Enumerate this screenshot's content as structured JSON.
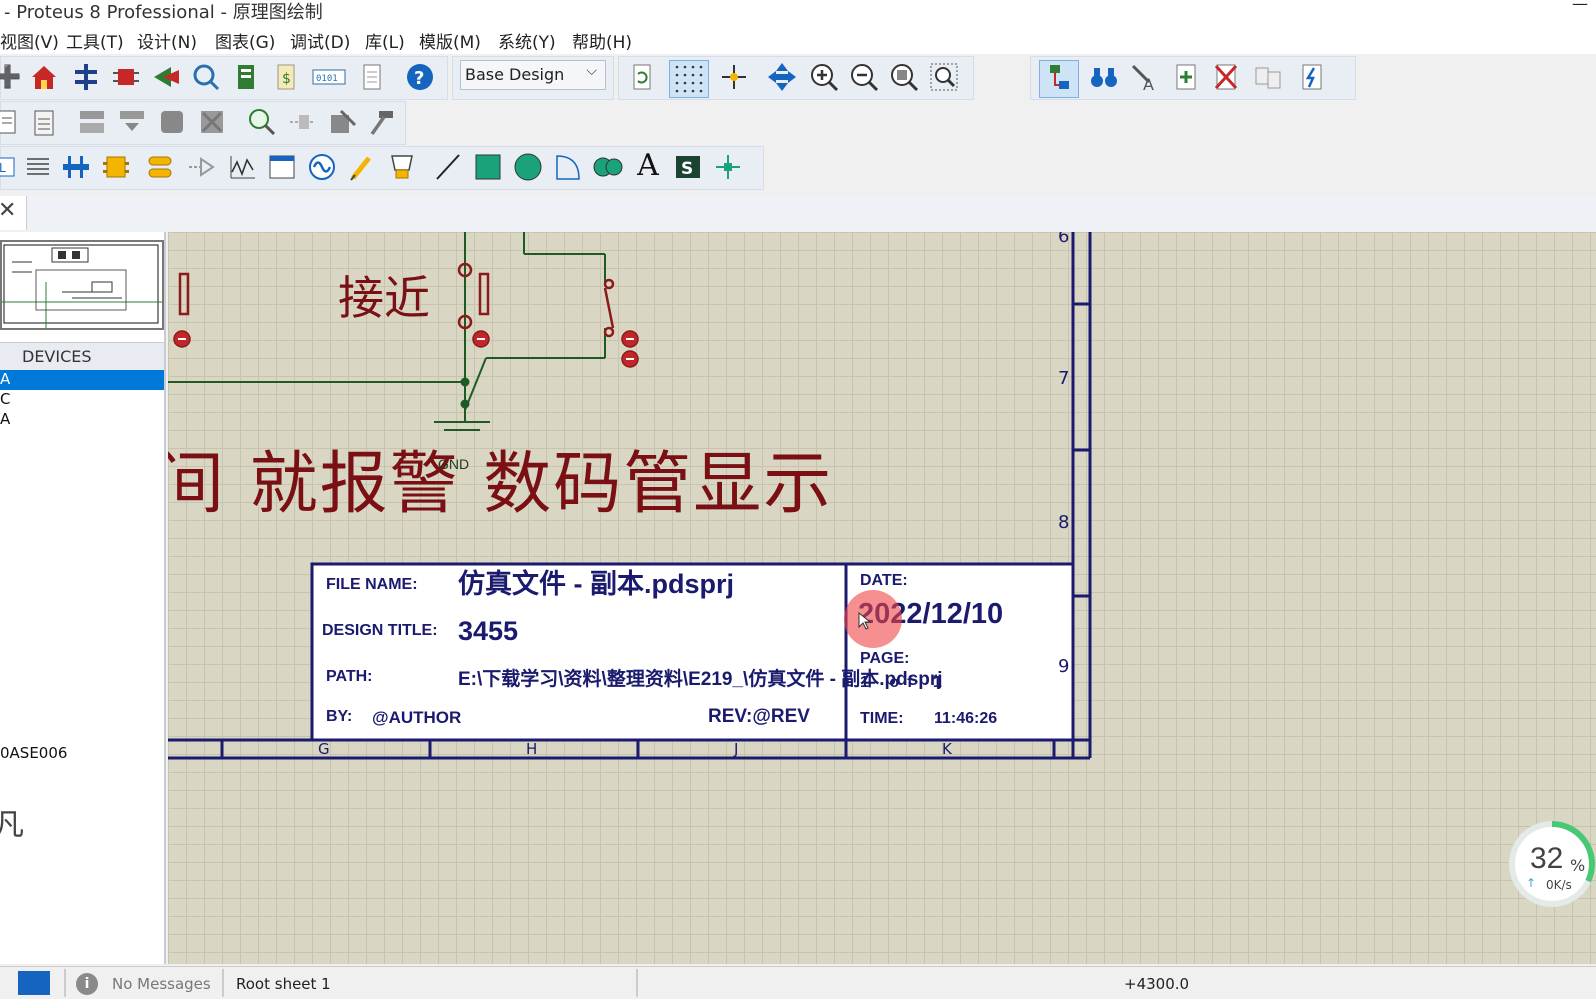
{
  "window": {
    "title": "- Proteus 8 Professional - 原理图绘制",
    "min_glyph": "—"
  },
  "menu": [
    "视图(V)",
    "工具(T)",
    "设计(N)",
    "图表(G)",
    "调试(D)",
    "库(L)",
    "模版(M)",
    "系统(Y)",
    "帮助(H)"
  ],
  "toolbar": {
    "design_select": "Base Design"
  },
  "tab": {
    "close_glyph": "✕"
  },
  "devices": {
    "header": "DEVICES",
    "items": [
      "A",
      "C",
      "A"
    ],
    "extra_item": "0ASE006",
    "bottom_glyph": "凡"
  },
  "schematic": {
    "label_near": "接近",
    "big_text": "间 就报警 数码管显示",
    "gnd_label": "GND",
    "row_labels": [
      "6",
      "7",
      "8",
      "9"
    ],
    "col_labels": [
      "G",
      "H",
      "J",
      "K"
    ],
    "title_block": {
      "file_name_label": "FILE NAME:",
      "file_name": "仿真文件 - 副本.pdsprj",
      "design_title_label": "DESIGN TITLE:",
      "design_title": "3455",
      "path_label": "PATH:",
      "path": "E:\\下载学习\\资料\\整理资料\\E219_\\仿真文件 - 副本.pdsprj",
      "by_label": "BY:",
      "by": "@AUTHOR",
      "rev": "REV:@REV",
      "date_label": "DATE:",
      "date": "2022/12/10",
      "page_label": "PAGE:",
      "page": "1 of 1",
      "time_label": "TIME:",
      "time": "11:46:26"
    }
  },
  "status": {
    "messages": "No Messages",
    "sheet": "Root sheet 1",
    "coord": "+4300.0"
  },
  "net_monitor": {
    "percent_value": 32,
    "percent": "32",
    "unit": "%",
    "speed": "0K/s",
    "up_glyph": "↑"
  }
}
